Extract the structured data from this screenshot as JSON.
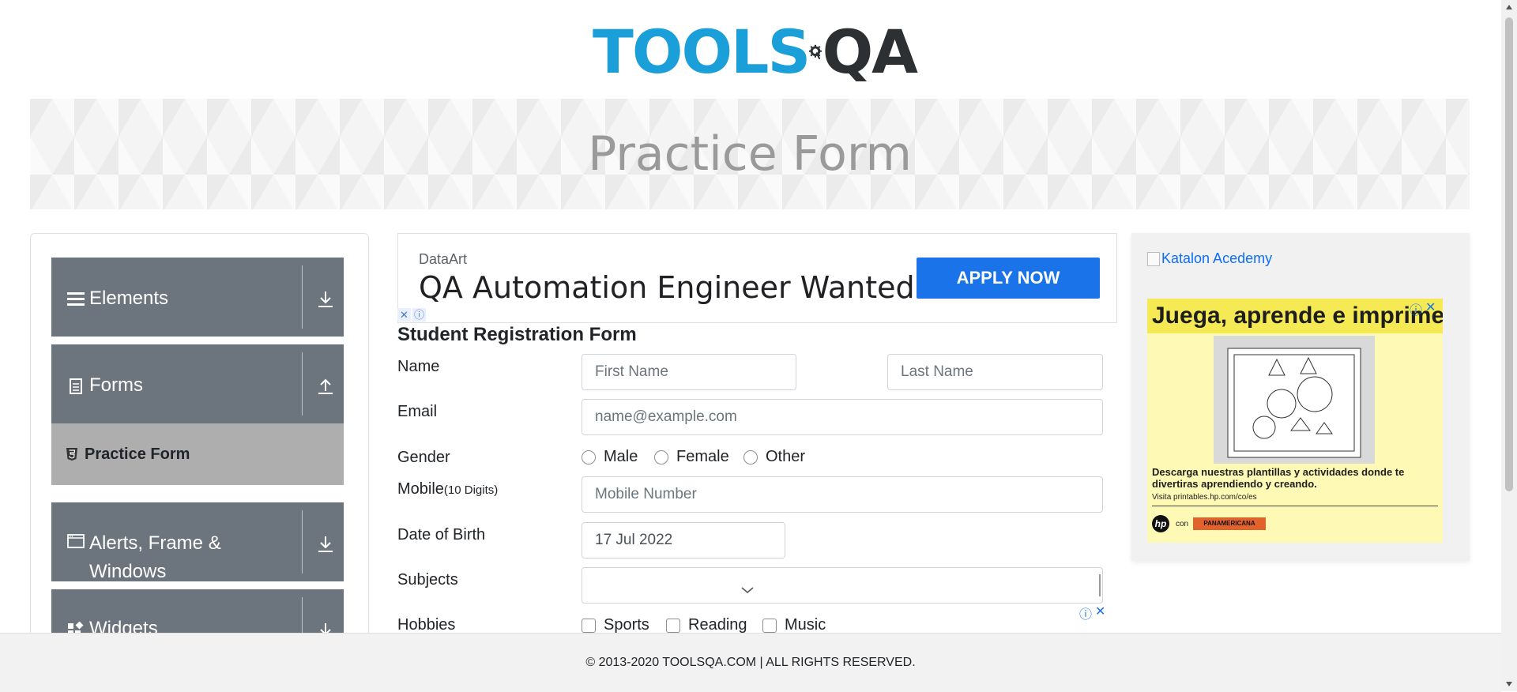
{
  "logo": {
    "part1": "TOOLS",
    "part2": "QA",
    "icon": "gear-magnifier-icon"
  },
  "banner": {
    "title": "Practice Form"
  },
  "sidebar": {
    "groups": [
      {
        "label": "Elements",
        "icon": "hamburger-icon",
        "state": "collapsed"
      },
      {
        "label": "Forms",
        "icon": "document-icon",
        "state": "expanded"
      },
      {
        "label": "Alerts, Frame &",
        "label2": "Windows",
        "icon": "window-icon",
        "state": "collapsed"
      },
      {
        "label": "Widgets",
        "icon": "widgets-icon",
        "state": "collapsed"
      }
    ],
    "active_item": {
      "label": "Practice Form",
      "icon": "html-icon"
    }
  },
  "ad_top": {
    "advertiser": "DataArt",
    "headline": "QA Automation Engineer Wanted",
    "button": "APPLY NOW"
  },
  "form": {
    "title": "Student Registration Form",
    "name_label": "Name",
    "first_name_placeholder": "First Name",
    "last_name_placeholder": "Last Name",
    "email_label": "Email",
    "email_placeholder": "name@example.com",
    "gender_label": "Gender",
    "gender_options": [
      "Male",
      "Female",
      "Other"
    ],
    "mobile_label": "Mobile",
    "mobile_hint": "(10 Digits)",
    "mobile_placeholder": "Mobile Number",
    "dob_label": "Date of Birth",
    "dob_value": "17 Jul 2022",
    "subjects_label": "Subjects",
    "hobbies_label": "Hobbies",
    "hobbies_options": [
      "Sports",
      "Reading",
      "Music"
    ]
  },
  "ad_right": {
    "broken_image_alt": "Katalon Acedemy",
    "promo_headline": "Juega, aprende e imprime",
    "promo_text": "Descarga nuestras plantillas y actividades donde te divertiras aprendiendo y creando.",
    "promo_url": "Visita printables.hp.com/co/es",
    "promo_con": "con",
    "promo_brand": "hp",
    "promo_partner": "PANAMERICANA"
  },
  "footer": {
    "text": "© 2013-2020 TOOLSQA.COM | ALL RIGHTS RESERVED."
  },
  "colors": {
    "accent": "#1b9fd9",
    "sidebar_group": "#6c757d",
    "active_item": "#aeaeae",
    "apply_button": "#1a73e8"
  }
}
